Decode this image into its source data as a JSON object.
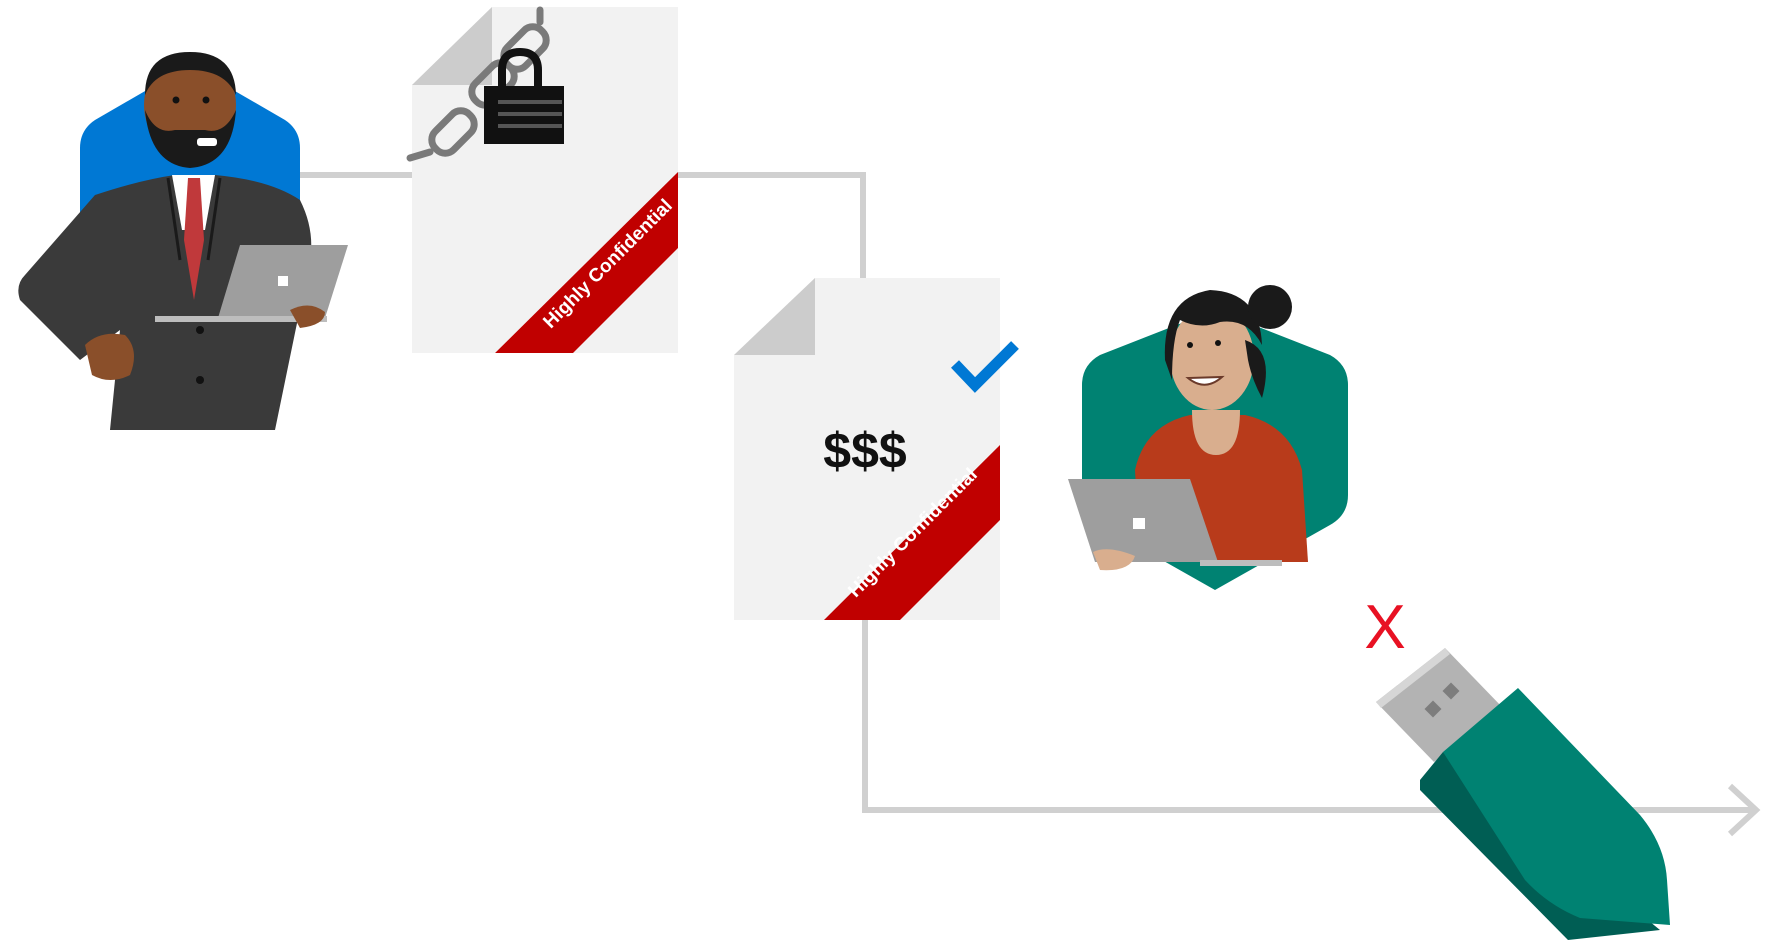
{
  "documents": {
    "protected": {
      "banner_label": "Highly Confidential"
    },
    "shared": {
      "banner_label": "Highly Confidential",
      "content_label": "$$$"
    }
  },
  "blocked_mark": {
    "label": "X"
  },
  "colors": {
    "flow_line": "#d0d0d0",
    "banner": "#c00000",
    "document": "#f2f2f2",
    "document_fold": "#cccccc",
    "check": "#0078d4",
    "blue_hex": "#0078d4",
    "teal_hex": "#008272",
    "usb_body": "#008272",
    "usb_shadow": "#005e54",
    "usb_connector": "#b3b3b3",
    "blocked": "#e81123"
  },
  "icons": [
    "lock-icon",
    "chain-icon",
    "checkmark-icon",
    "usb-drive-icon",
    "arrow-head-icon",
    "laptop-icon"
  ]
}
